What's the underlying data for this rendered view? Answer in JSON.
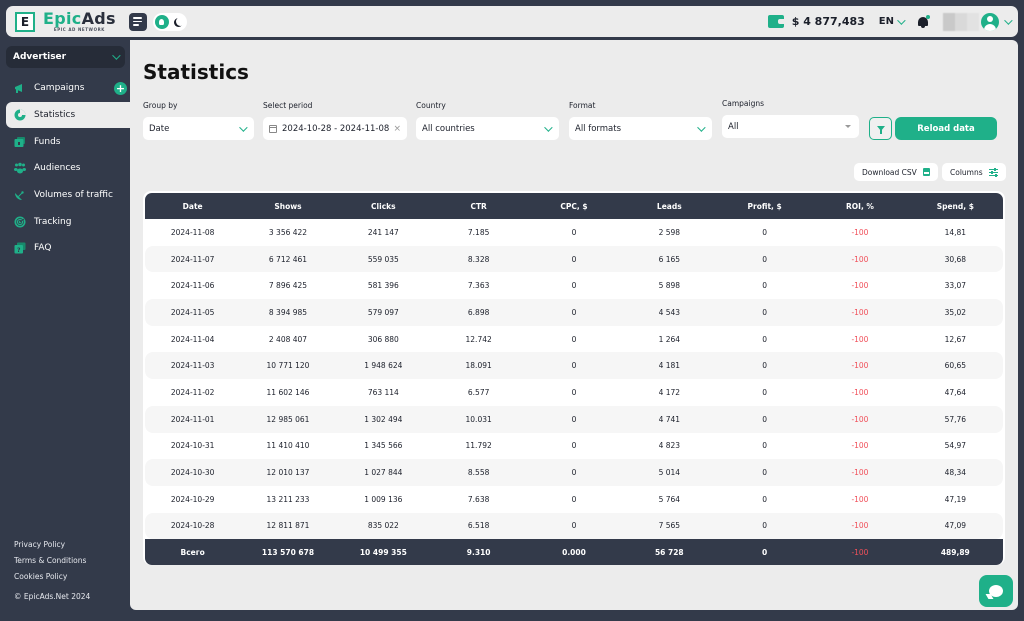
{
  "header": {
    "logo_mark": "E",
    "logo_epic": "Epic",
    "logo_ads": "Ads",
    "logo_tagline": "EPIC AD NETWORK",
    "balance": "$ 4 877,483",
    "language": "EN"
  },
  "sidebar": {
    "role": "Advertiser",
    "items": [
      {
        "label": "Campaigns",
        "icon": "megaphone-icon",
        "has_add": true
      },
      {
        "label": "Statistics",
        "icon": "pie-chart-icon",
        "active": true
      },
      {
        "label": "Funds",
        "icon": "wallet-icon"
      },
      {
        "label": "Audiences",
        "icon": "users-icon"
      },
      {
        "label": "Volumes of traffic",
        "icon": "satellite-icon"
      },
      {
        "label": "Tracking",
        "icon": "radar-icon"
      },
      {
        "label": "FAQ",
        "icon": "faq-icon"
      }
    ],
    "add_label": "+",
    "footer": {
      "privacy": "Privacy Policy",
      "terms": "Terms & Conditions",
      "cookies": "Cookies Policy",
      "copyright": "© EpicAds.Net 2024"
    }
  },
  "main": {
    "title": "Statistics",
    "filters": {
      "group_by": {
        "label": "Group by",
        "value": "Date"
      },
      "period": {
        "label": "Select period",
        "value": "2024-10-28 - 2024-11-08",
        "clear": "×"
      },
      "country": {
        "label": "Country",
        "value": "All countries"
      },
      "format": {
        "label": "Format",
        "value": "All formats"
      },
      "campaigns": {
        "label": "Campaigns",
        "value": "All"
      },
      "reload_label": "Reload data"
    },
    "download_csv_label": "Download CSV",
    "columns_label": "Columns"
  },
  "table": {
    "columns": [
      "Date",
      "Shows",
      "Clicks",
      "CTR",
      "CPC, $",
      "Leads",
      "Profit, $",
      "ROI, %",
      "Spend, $"
    ],
    "rows": [
      [
        "2024-11-08",
        "3 356 422",
        "241 147",
        "7.185",
        "0",
        "2 598",
        "0",
        "-100",
        "14,81"
      ],
      [
        "2024-11-07",
        "6 712 461",
        "559 035",
        "8.328",
        "0",
        "6 165",
        "0",
        "-100",
        "30,68"
      ],
      [
        "2024-11-06",
        "7 896 425",
        "581 396",
        "7.363",
        "0",
        "5 898",
        "0",
        "-100",
        "33,07"
      ],
      [
        "2024-11-05",
        "8 394 985",
        "579 097",
        "6.898",
        "0",
        "4 543",
        "0",
        "-100",
        "35,02"
      ],
      [
        "2024-11-04",
        "2 408 407",
        "306 880",
        "12.742",
        "0",
        "1 264",
        "0",
        "-100",
        "12,67"
      ],
      [
        "2024-11-03",
        "10 771 120",
        "1 948 624",
        "18.091",
        "0",
        "4 181",
        "0",
        "-100",
        "60,65"
      ],
      [
        "2024-11-02",
        "11 602 146",
        "763 114",
        "6.577",
        "0",
        "4 172",
        "0",
        "-100",
        "47,64"
      ],
      [
        "2024-11-01",
        "12 985 061",
        "1 302 494",
        "10.031",
        "0",
        "4 741",
        "0",
        "-100",
        "57,76"
      ],
      [
        "2024-10-31",
        "11 410 410",
        "1 345 566",
        "11.792",
        "0",
        "4 823",
        "0",
        "-100",
        "54,97"
      ],
      [
        "2024-10-30",
        "12 010 137",
        "1 027 844",
        "8.558",
        "0",
        "5 014",
        "0",
        "-100",
        "48,34"
      ],
      [
        "2024-10-29",
        "13 211 233",
        "1 009 136",
        "7.638",
        "0",
        "5 764",
        "0",
        "-100",
        "47,19"
      ],
      [
        "2024-10-28",
        "12 811 871",
        "835 022",
        "6.518",
        "0",
        "7 565",
        "0",
        "-100",
        "47,09"
      ]
    ],
    "total": [
      "Всего",
      "113 570 678",
      "10 499 355",
      "9.310",
      "0.000",
      "56 728",
      "0",
      "-100",
      "489,89"
    ]
  },
  "colors": {
    "accent": "#1fb089",
    "dark": "#333a4a",
    "negative": "#f0505a"
  }
}
